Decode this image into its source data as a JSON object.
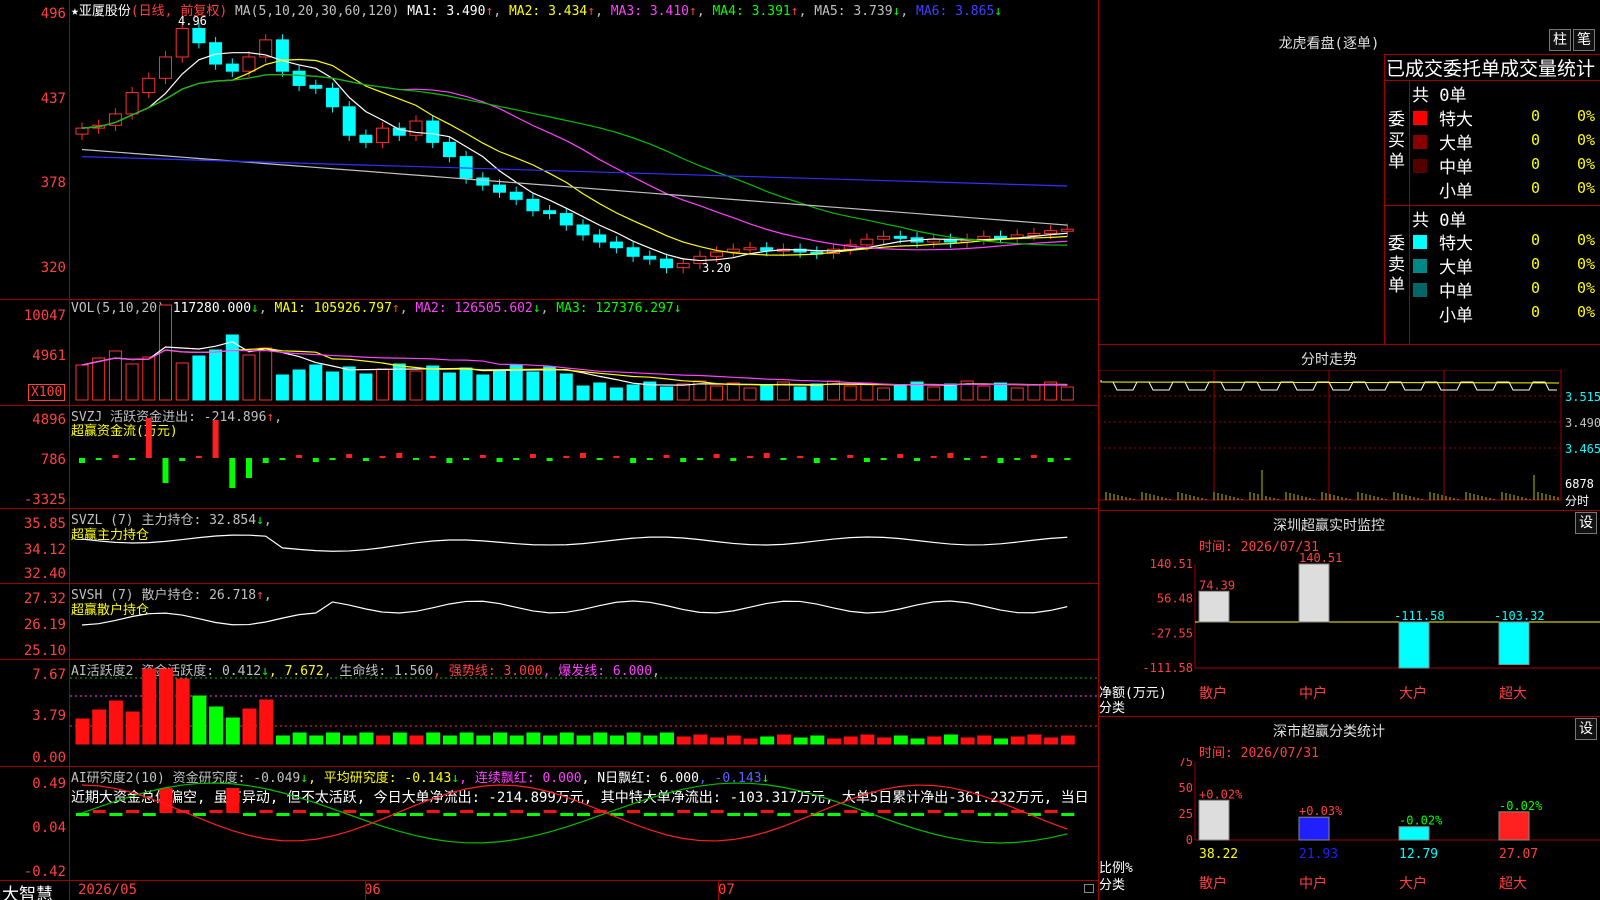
{
  "stock": {
    "star": "★",
    "name": "亚厦股份",
    "mode": "(日线, 前复权)"
  },
  "main": {
    "ma_label": "MA(5,10,20,30,60,120)",
    "ma": [
      {
        "label": "MA1: 3.490",
        "arrow": "↑",
        "color": "#ffffff"
      },
      {
        "label": "MA2: 3.434",
        "arrow": "↑",
        "color": "#ffff00"
      },
      {
        "label": "MA3: 3.410",
        "arrow": "↑",
        "color": "#ff40ff"
      },
      {
        "label": "MA4: 3.391",
        "arrow": "↑",
        "color": "#00ff00"
      },
      {
        "label": "MA5: 3.739",
        "arrow": "↓",
        "color": "#c0c0c0"
      },
      {
        "label": "MA6: 3.865",
        "arrow": "↓",
        "color": "#4040ff"
      }
    ],
    "y_ticks": [
      "496",
      "437",
      "378",
      "320"
    ],
    "high_label": "4.96",
    "low_label": "3.20"
  },
  "vol": {
    "title": "VOL(5,10,20)",
    "value": "117280.000",
    "arrow": "↓",
    "ma1": "MA1: 105926.797",
    "ma1_arrow": "↑",
    "ma2": "MA2: 126505.602",
    "ma2_arrow": "↓",
    "ma3": "MA3: 127376.297",
    "ma3_arrow": "↓",
    "y_ticks": [
      "10047",
      "4961"
    ],
    "unit": "X100"
  },
  "svzj": {
    "title": "SVZJ  活跃资金进出: -214.896",
    "arrow": "↑",
    "subtitle": "超赢资金流(万元)",
    "y_ticks": [
      "4896",
      "786",
      "-3325"
    ]
  },
  "svzl": {
    "title": "SVZL (7) 主力持仓: 32.854",
    "arrow": "↓",
    "tail": ",",
    "subtitle": "超赢主力持仓",
    "y_ticks": [
      "35.85",
      "34.12",
      "32.40"
    ]
  },
  "svsh": {
    "title": "SVSH (7) 散户持仓: 26.718",
    "arrow": "↑",
    "tail": ",",
    "subtitle": "超赢散户持仓",
    "y_ticks": [
      "27.32",
      "26.19",
      "25.10"
    ]
  },
  "ai1": {
    "title": "AI活跃度2 资金活跃度: 0.412",
    "arrow1": "↓",
    "v2": ", 7.672",
    "life": ", 生命线: 1.560",
    "strong": ", 强势线: 3.000",
    "burst": ", 爆发线: 6.000",
    "tail": ",",
    "y_ticks": [
      "7.67",
      "3.79",
      "0.00"
    ]
  },
  "ai2": {
    "title": "AI研究度2(10) 资金研究度: -0.049",
    "arrow1": "↓",
    "avg": ", 平均研究度: -0.143",
    "arrow2": "↓",
    "red": ", 连续飘红: 0.000",
    "nday": ", N日飘红: 6.000",
    "last": ", -0.143",
    "arrow3": "↓",
    "desc": "近期大资金总体偏空, 虽有异动, 但不太活跃, 今日大单净流出: -214.899万元, 其中特大单净流出: -103.317万元, 大单5日累计净出-361.232万元, 当日",
    "y_ticks": [
      "0.49",
      "0.04",
      "-0.42"
    ]
  },
  "bottom": {
    "logo": "大智慧",
    "dates": [
      "2026/05",
      "06",
      "07"
    ]
  },
  "right": {
    "lhb_title": "龙虎看盘(逐单)",
    "btn1": "柱",
    "btn2": "笔",
    "header": "已成交委托单成交量统计",
    "buy": {
      "side": "委买单",
      "total": "共 0单",
      "rows": [
        {
          "label": "特大",
          "value": "0",
          "pct": "0%",
          "color": "#ff0000"
        },
        {
          "label": "大单",
          "value": "0",
          "pct": "0%",
          "color": "#880000"
        },
        {
          "label": "中单",
          "value": "0",
          "pct": "0%",
          "color": "#550000"
        },
        {
          "label": "小单",
          "value": "0",
          "pct": "0%",
          "color": "#000000"
        }
      ]
    },
    "sell": {
      "side": "委卖单",
      "total": "共 0单",
      "rows": [
        {
          "label": "特大",
          "value": "0",
          "pct": "0%",
          "color": "#00ffff"
        },
        {
          "label": "大单",
          "value": "0",
          "pct": "0%",
          "color": "#008888"
        },
        {
          "label": "中单",
          "value": "0",
          "pct": "0%",
          "color": "#006666"
        },
        {
          "label": "小单",
          "value": "0",
          "pct": "0%",
          "color": "#000000"
        }
      ]
    },
    "intraday": {
      "title": "分时走势",
      "y_ticks": [
        "3.515",
        "3.490",
        "3.465"
      ],
      "vol_tick": "6878",
      "vol_unit": "分时"
    },
    "monitor": {
      "title": "深圳超赢实时监控",
      "settings": "设",
      "time": "时间: 2026/07/31",
      "y_ticks": [
        "140.51",
        "56.48",
        "-27.55",
        "-111.58"
      ],
      "ylabel": "净额(万元)",
      "xlabel": "分类"
    },
    "classify": {
      "title": "深市超赢分类统计",
      "settings": "设",
      "time": "时间: 2026/07/31",
      "y_ticks": [
        "75",
        "50",
        "25",
        "0"
      ],
      "ylabel": "比例%",
      "xlabel": "分类"
    }
  },
  "chart_data": [
    {
      "type": "bar",
      "title": "深圳超赢实时监控",
      "categories": [
        "散户",
        "中户",
        "大户",
        "超大"
      ],
      "values": [
        74.39,
        140.51,
        -111.58,
        -103.32
      ],
      "ylim": [
        -111.58,
        140.51
      ]
    },
    {
      "type": "bar",
      "title": "深市超赢分类统计",
      "categories": [
        "散户",
        "中户",
        "大户",
        "超大"
      ],
      "values": [
        38.22,
        21.93,
        12.79,
        27.07
      ],
      "change_labels": [
        "+0.02%",
        "+0.03%",
        "-0.02%",
        "-0.02%"
      ],
      "ylim": [
        0,
        75
      ]
    }
  ]
}
